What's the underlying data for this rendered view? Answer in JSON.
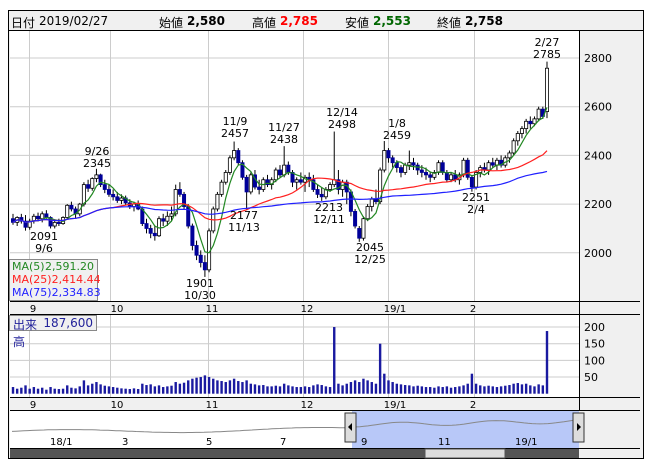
{
  "header": {
    "date_label": "日付",
    "date": "2019/02/27",
    "open_label": "始値",
    "open": "2,580",
    "high_label": "高値",
    "high": "2,785",
    "low_label": "安値",
    "low": "2,553",
    "close_label": "終値",
    "close": "2,758"
  },
  "colors": {
    "up": "#ffffff",
    "down": "#000099",
    "ma5": "#228822",
    "ma25": "#ff2020",
    "ma75": "#2020ff",
    "high": "#ff0000",
    "low": "#006600",
    "nav_fill": "#b8c8f8"
  },
  "legend": {
    "ma5_label": "MA(5)",
    "ma5": "2,591.20",
    "ma25_label": "MA(25)",
    "ma25": "2,414.44",
    "ma75_label": "MA(75)",
    "ma75": "2,334.83"
  },
  "volume": {
    "label": "出来高",
    "value": "187,600"
  },
  "annotations": [
    {
      "date": "9/26",
      "value": "2345"
    },
    {
      "date": "9/6",
      "value": "2091"
    },
    {
      "date": "10/30",
      "value": "1901"
    },
    {
      "date": "11/9",
      "value": "2457"
    },
    {
      "date": "11/13",
      "value": "2177"
    },
    {
      "date": "11/27",
      "value": "2438"
    },
    {
      "date": "12/14",
      "value": "2498"
    },
    {
      "date": "12/11",
      "value": "2213"
    },
    {
      "date": "12/25",
      "value": "2045"
    },
    {
      "date": "1/8",
      "value": "2459"
    },
    {
      "date": "2/4",
      "value": "2251"
    },
    {
      "date": "2/27",
      "value": "2785"
    }
  ],
  "navigator": {
    "labels": [
      "18/1",
      "3",
      "5",
      "7",
      "9",
      "11",
      "19/1"
    ]
  },
  "chart_data": {
    "type": "candlestick",
    "price_axis": {
      "ticks": [
        "2800",
        "2600",
        "2400",
        "2200",
        "2000"
      ],
      "range": [
        1770,
        2910
      ]
    },
    "volume_axis": {
      "ticks": [
        "200",
        "150",
        "100",
        "50"
      ],
      "range": [
        0,
        210
      ],
      "unit": "thousand shares"
    },
    "month_labels": [
      "9",
      "10",
      "11",
      "12",
      "19/1",
      "2"
    ],
    "ma_periods": [
      5,
      25,
      75
    ],
    "ohlcv": [
      [
        2140,
        2160,
        2115,
        2125,
        20
      ],
      [
        2125,
        2150,
        2110,
        2145,
        15
      ],
      [
        2145,
        2160,
        2120,
        2130,
        18
      ],
      [
        2130,
        2155,
        2091,
        2105,
        25
      ],
      [
        2105,
        2140,
        2095,
        2130,
        15
      ],
      [
        2130,
        2160,
        2120,
        2150,
        20
      ],
      [
        2150,
        2165,
        2130,
        2140,
        15
      ],
      [
        2140,
        2170,
        2125,
        2160,
        18
      ],
      [
        2160,
        2175,
        2140,
        2145,
        12
      ],
      [
        2145,
        2150,
        2100,
        2110,
        20
      ],
      [
        2110,
        2135,
        2100,
        2125,
        15
      ],
      [
        2125,
        2140,
        2110,
        2120,
        14
      ],
      [
        2120,
        2150,
        2115,
        2145,
        15
      ],
      [
        2145,
        2200,
        2140,
        2195,
        25
      ],
      [
        2195,
        2210,
        2170,
        2180,
        18
      ],
      [
        2180,
        2190,
        2140,
        2160,
        16
      ],
      [
        2160,
        2205,
        2150,
        2200,
        22
      ],
      [
        2200,
        2290,
        2190,
        2280,
        40
      ],
      [
        2280,
        2300,
        2250,
        2265,
        25
      ],
      [
        2265,
        2310,
        2255,
        2305,
        30
      ],
      [
        2305,
        2345,
        2290,
        2320,
        35
      ],
      [
        2320,
        2325,
        2270,
        2280,
        28
      ],
      [
        2280,
        2300,
        2245,
        2260,
        24
      ],
      [
        2260,
        2280,
        2230,
        2240,
        22
      ],
      [
        2240,
        2260,
        2215,
        2230,
        20
      ],
      [
        2230,
        2250,
        2205,
        2215,
        18
      ],
      [
        2215,
        2240,
        2200,
        2225,
        16
      ],
      [
        2225,
        2235,
        2195,
        2205,
        15
      ],
      [
        2205,
        2220,
        2180,
        2190,
        14
      ],
      [
        2190,
        2210,
        2170,
        2200,
        16
      ],
      [
        2200,
        2215,
        2175,
        2180,
        14
      ],
      [
        2180,
        2190,
        2110,
        2120,
        30
      ],
      [
        2120,
        2140,
        2080,
        2100,
        26
      ],
      [
        2100,
        2115,
        2060,
        2080,
        28
      ],
      [
        2080,
        2110,
        2050,
        2070,
        22
      ],
      [
        2070,
        2150,
        2065,
        2140,
        25
      ],
      [
        2140,
        2160,
        2110,
        2130,
        20
      ],
      [
        2130,
        2170,
        2110,
        2150,
        22
      ],
      [
        2150,
        2190,
        2130,
        2160,
        24
      ],
      [
        2160,
        2280,
        2150,
        2260,
        35
      ],
      [
        2260,
        2290,
        2230,
        2240,
        30
      ],
      [
        2240,
        2250,
        2180,
        2190,
        33
      ],
      [
        2190,
        2200,
        2100,
        2110,
        40
      ],
      [
        2110,
        2120,
        2010,
        2030,
        45
      ],
      [
        2030,
        2050,
        1970,
        1990,
        48
      ],
      [
        1990,
        2010,
        1940,
        1960,
        50
      ],
      [
        1960,
        1990,
        1901,
        1930,
        55
      ],
      [
        1930,
        2100,
        1920,
        2090,
        50
      ],
      [
        2090,
        2190,
        2080,
        2180,
        45
      ],
      [
        2180,
        2250,
        2170,
        2240,
        40
      ],
      [
        2240,
        2300,
        2230,
        2290,
        38
      ],
      [
        2290,
        2340,
        2280,
        2330,
        35
      ],
      [
        2330,
        2400,
        2320,
        2390,
        40
      ],
      [
        2390,
        2457,
        2380,
        2420,
        45
      ],
      [
        2420,
        2430,
        2360,
        2370,
        38
      ],
      [
        2370,
        2380,
        2300,
        2310,
        35
      ],
      [
        2310,
        2320,
        2177,
        2250,
        40
      ],
      [
        2250,
        2330,
        2240,
        2320,
        30
      ],
      [
        2320,
        2340,
        2260,
        2270,
        28
      ],
      [
        2270,
        2300,
        2240,
        2260,
        25
      ],
      [
        2260,
        2310,
        2250,
        2300,
        26
      ],
      [
        2300,
        2320,
        2270,
        2280,
        22
      ],
      [
        2280,
        2310,
        2260,
        2300,
        22
      ],
      [
        2300,
        2350,
        2290,
        2340,
        24
      ],
      [
        2340,
        2360,
        2310,
        2320,
        22
      ],
      [
        2320,
        2438,
        2310,
        2360,
        30
      ],
      [
        2360,
        2375,
        2320,
        2330,
        25
      ],
      [
        2330,
        2340,
        2270,
        2290,
        22
      ],
      [
        2290,
        2310,
        2260,
        2300,
        20
      ],
      [
        2300,
        2330,
        2280,
        2290,
        20
      ],
      [
        2290,
        2320,
        2250,
        2310,
        22
      ],
      [
        2310,
        2330,
        2270,
        2300,
        20
      ],
      [
        2300,
        2320,
        2250,
        2260,
        25
      ],
      [
        2260,
        2280,
        2225,
        2240,
        28
      ],
      [
        2240,
        2270,
        2213,
        2230,
        26
      ],
      [
        2230,
        2270,
        2220,
        2260,
        22
      ],
      [
        2260,
        2290,
        2250,
        2280,
        20
      ],
      [
        2280,
        2498,
        2270,
        2300,
        200
      ],
      [
        2300,
        2340,
        2240,
        2260,
        30
      ],
      [
        2260,
        2300,
        2230,
        2290,
        25
      ],
      [
        2290,
        2300,
        2200,
        2250,
        30
      ],
      [
        2250,
        2260,
        2150,
        2170,
        35
      ],
      [
        2170,
        2180,
        2100,
        2110,
        40
      ],
      [
        2100,
        2110,
        2045,
        2060,
        35
      ],
      [
        2060,
        2150,
        2050,
        2140,
        45
      ],
      [
        2140,
        2200,
        2130,
        2190,
        40
      ],
      [
        2190,
        2230,
        2170,
        2220,
        35
      ],
      [
        2220,
        2260,
        2200,
        2210,
        30
      ],
      [
        2210,
        2350,
        2200,
        2340,
        150
      ],
      [
        2340,
        2459,
        2330,
        2420,
        60
      ],
      [
        2420,
        2430,
        2370,
        2390,
        40
      ],
      [
        2390,
        2400,
        2350,
        2370,
        35
      ],
      [
        2370,
        2380,
        2330,
        2350,
        30
      ],
      [
        2350,
        2360,
        2310,
        2330,
        28
      ],
      [
        2330,
        2370,
        2320,
        2360,
        26
      ],
      [
        2360,
        2420,
        2340,
        2370,
        25
      ],
      [
        2370,
        2390,
        2340,
        2360,
        22
      ],
      [
        2360,
        2370,
        2320,
        2340,
        24
      ],
      [
        2340,
        2360,
        2310,
        2330,
        22
      ],
      [
        2330,
        2350,
        2300,
        2320,
        20
      ],
      [
        2320,
        2330,
        2290,
        2310,
        20
      ],
      [
        2310,
        2340,
        2300,
        2330,
        18
      ],
      [
        2330,
        2380,
        2320,
        2370,
        22
      ],
      [
        2370,
        2380,
        2320,
        2330,
        20
      ],
      [
        2330,
        2340,
        2290,
        2300,
        22
      ],
      [
        2300,
        2330,
        2290,
        2320,
        18
      ],
      [
        2320,
        2340,
        2290,
        2300,
        20
      ],
      [
        2300,
        2330,
        2280,
        2320,
        22
      ],
      [
        2320,
        2390,
        2310,
        2380,
        25
      ],
      [
        2380,
        2390,
        2300,
        2310,
        30
      ],
      [
        2310,
        2320,
        2251,
        2270,
        60
      ],
      [
        2270,
        2340,
        2260,
        2330,
        30
      ],
      [
        2330,
        2360,
        2310,
        2350,
        25
      ],
      [
        2350,
        2370,
        2330,
        2340,
        22
      ],
      [
        2340,
        2380,
        2320,
        2370,
        24
      ],
      [
        2370,
        2390,
        2350,
        2360,
        22
      ],
      [
        2360,
        2390,
        2340,
        2380,
        20
      ],
      [
        2380,
        2400,
        2350,
        2360,
        22
      ],
      [
        2360,
        2400,
        2350,
        2390,
        24
      ],
      [
        2390,
        2420,
        2370,
        2410,
        26
      ],
      [
        2410,
        2470,
        2400,
        2460,
        30
      ],
      [
        2460,
        2500,
        2440,
        2490,
        32
      ],
      [
        2490,
        2520,
        2470,
        2510,
        28
      ],
      [
        2510,
        2550,
        2490,
        2540,
        30
      ],
      [
        2540,
        2560,
        2510,
        2530,
        25
      ],
      [
        2530,
        2560,
        2520,
        2550,
        22
      ],
      [
        2550,
        2600,
        2540,
        2590,
        28
      ],
      [
        2590,
        2600,
        2550,
        2560,
        25
      ],
      [
        2580,
        2785,
        2553,
        2758,
        188
      ]
    ]
  }
}
